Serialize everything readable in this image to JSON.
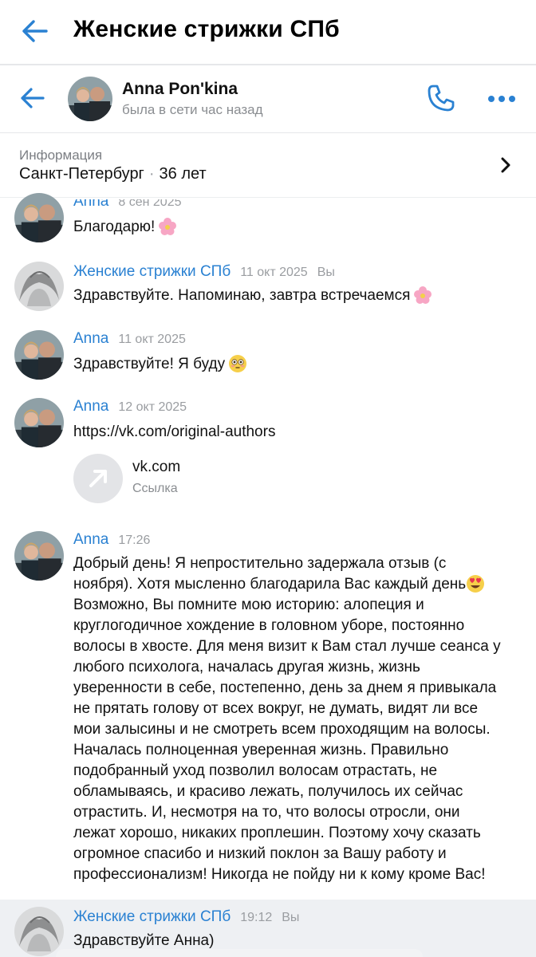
{
  "header": {
    "title": "Женские стрижки СПб"
  },
  "chat": {
    "name": "Anna Pon'kina",
    "status": "была в сети час назад"
  },
  "info": {
    "label": "Информация",
    "city": "Санкт-Петербург",
    "age": "36 лет"
  },
  "messages": [
    {
      "author": "Anna",
      "time": "8 сен 2025",
      "text": "Благодарю!"
    },
    {
      "author": "Женские стрижки СПб",
      "time": "11 окт 2025",
      "you": "Вы",
      "text": "Здравствуйте. Напоминаю, завтра встречаемся"
    },
    {
      "author": "Anna",
      "time": "11 окт 2025",
      "text": "Здравствуйте! Я буду"
    },
    {
      "author": "Anna",
      "time": "12 окт 2025",
      "link": "https://vk.com/original-authors",
      "card_title": "vk.com",
      "card_sub": "Ссылка"
    },
    {
      "author": "Anna",
      "time": "17:26",
      "text": "Добрый день! Я непростительно задержала отзыв (с ноября). Хотя мысленно благодарила Вас каждый день"
    },
    {
      "author": "Женские стрижки СПб",
      "time": "19:12",
      "you": "Вы",
      "text": "Здравствуйте Анна)"
    }
  ],
  "long_text": [
    "Добрый день! Я непростительно задержала отзыв (с",
    "ноября). Хотя мысленно благодарила Вас каждый день",
    "Возможно, Вы помните мою историю: алопеция и",
    "круглогодичное хождение в головном уборе, постоянно",
    "волосы в хвосте. Для меня визит к Вам стал лучше сеанса у",
    "любого психолога, началась другая жизнь, жизнь",
    "уверенности в себе, постепенно, день за днем я привыкала",
    "не прятать голову от всех вокруг, не думать, видят ли все",
    "мои залысины и не смотреть всем проходящим на волосы.",
    "Началась полноценная уверенная жизнь. Правильно",
    "подобранный уход позволил волосам отрастать, не",
    "обламываясь, и красиво лежать, получилось их сейчас",
    "отрастить. И, несмотря на то, что волосы отросли, они",
    "лежат хорошо, никаких проплешин. Поэтому хочу сказать",
    "огромное спасибо и низкий поклон за Вашу работу и",
    "профессионализм! Никогда не пойду ни к кому кроме Вас!"
  ],
  "colors": {
    "accent": "#2a81d2",
    "muted": "#9a9da1"
  },
  "icons": [
    "back-arrow-icon",
    "phone-icon",
    "more-dots-icon",
    "chevron-right-icon",
    "link-arrow-icon",
    "flower-emoji",
    "flushed-emoji",
    "heart-eyes-emoji"
  ]
}
